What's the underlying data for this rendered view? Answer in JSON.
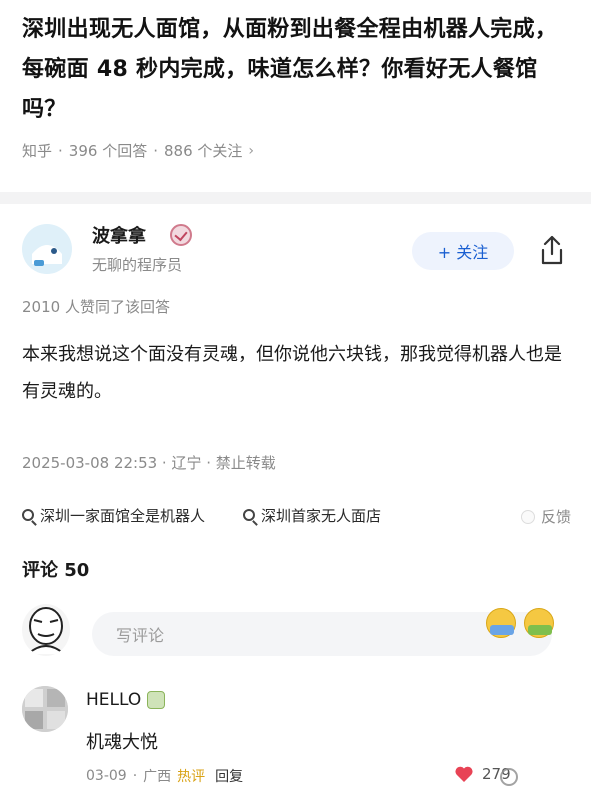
{
  "question": {
    "title": "深圳出现无人面馆，从面粉到出餐全程由机器人完成，每碗面 48 秒内完成，味道怎么样？你看好无人餐馆吗？",
    "site": "知乎",
    "answers": "396 个回答",
    "followers": "886 个关注",
    "sep": "·"
  },
  "author": {
    "name": "波拿拿",
    "desc": "无聊的程序员",
    "follow_label": "+ 关注"
  },
  "answer": {
    "upvotes": "2010 人赞同了该回答",
    "text": "本来我想说这个面没有灵魂，但你说他六块钱，那我觉得机器人也是有灵魂的。",
    "meta": "2025-03-08 22:53 · 辽宁 · 禁止转载"
  },
  "search": {
    "chips": [
      "深圳一家面馆全是机器人",
      "深圳首家无人面店"
    ],
    "feedback": "反馈"
  },
  "comments": {
    "title": "评论 50",
    "input_placeholder": "写评论",
    "items": [
      {
        "name": "HELLO",
        "text": "机魂大悦",
        "date": "03-09",
        "location": "广西",
        "hot": "热评",
        "reply": "回复",
        "likes": "279"
      }
    ]
  },
  "icons": {
    "share": "share-icon",
    "search": "search-icon",
    "heart": "heart-icon",
    "verified": "verified-badge-icon"
  },
  "colors": {
    "accent": "#1a5fd1",
    "hot": "#d9a214",
    "heart": "#e84355"
  }
}
